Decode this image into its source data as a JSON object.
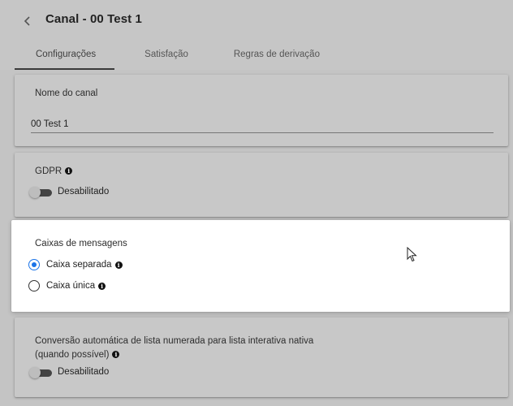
{
  "header": {
    "back_icon": "chevron-left-icon",
    "title": "Canal - 00 Test 1"
  },
  "tabs": [
    {
      "label": "Configurações",
      "active": true
    },
    {
      "label": "Satisfação",
      "active": false
    },
    {
      "label": "Regras de derivação",
      "active": false
    }
  ],
  "channel_name": {
    "label": "Nome do canal",
    "value": "00 Test 1"
  },
  "gdpr": {
    "label": "GDPR",
    "info_icon": "info-icon",
    "toggle_state": "off",
    "toggle_label": "Desabilitado"
  },
  "message_boxes": {
    "label": "Caixas de mensagens",
    "options": [
      {
        "label": "Caixa separada",
        "selected": true
      },
      {
        "label": "Caixa única",
        "selected": false
      }
    ]
  },
  "auto_conversion": {
    "label_line1": "Conversão automática de lista numerada para lista interativa nativa",
    "label_line2": "(quando possível)",
    "toggle_state": "off",
    "toggle_label": "Desabilitado"
  },
  "colors": {
    "background": "#c4c4c4",
    "card_focused": "#ffffff",
    "radio_selected": "#1a73e8",
    "toggle_track": "#444444"
  }
}
